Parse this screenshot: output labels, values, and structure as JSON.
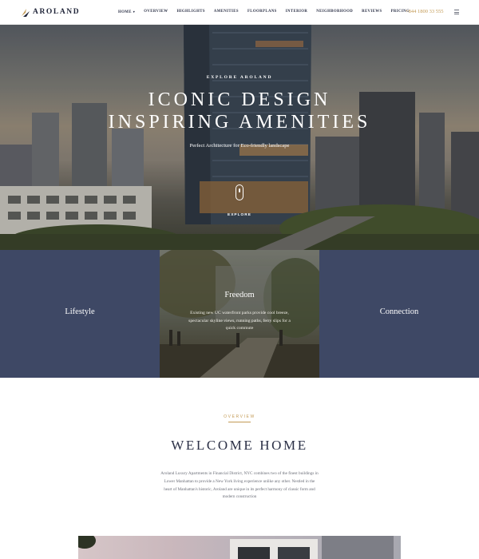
{
  "header": {
    "logo_text": "AROLAND",
    "nav": [
      {
        "label": "HOME",
        "has_caret": true
      },
      {
        "label": "OVERVIEW"
      },
      {
        "label": "HIGHLIGHTS"
      },
      {
        "label": "AMENITIES"
      },
      {
        "label": "FLOORPLANS"
      },
      {
        "label": "INTERIOR"
      },
      {
        "label": "NEIGHBORHOOD"
      },
      {
        "label": "REVIEWS"
      },
      {
        "label": "PRICING"
      }
    ],
    "phone": "+844 1800 33 555",
    "menu_icon": "hamburger-icon"
  },
  "hero": {
    "eyebrow": "EXPLORE AROLAND",
    "title_line1": "ICONIC DESIGN",
    "title_line2": "INSPIRING AMENITIES",
    "subtitle": "Perfect Architecture for Eco-friendly landscape",
    "scroll_icon": "mouse-scroll-icon",
    "explore_label": "EXPLORE"
  },
  "features": [
    {
      "label": "Lifestyle"
    },
    {
      "label": "Freedom",
      "description": "Existing new UC waterfront parks provide cool breeze, spectacular skyline views, running paths, ferry slips for a quick commute"
    },
    {
      "label": "Connection"
    }
  ],
  "welcome": {
    "eyebrow": "OVERVIEW",
    "title": "WELCOME HOME",
    "body": "Aroland Luxury Apartments in Financial District, NYC combines two of the finest buildings in Lower Manhattan to provide a New York living experience unlike any other. Nestled in the heart of Manhattan's historic, Aroland are unique in its perfect harmony of classic form and modern construction"
  },
  "colors": {
    "accent_gold": "#c39a55",
    "navy": "#3e4865",
    "heading": "#2b3046"
  }
}
